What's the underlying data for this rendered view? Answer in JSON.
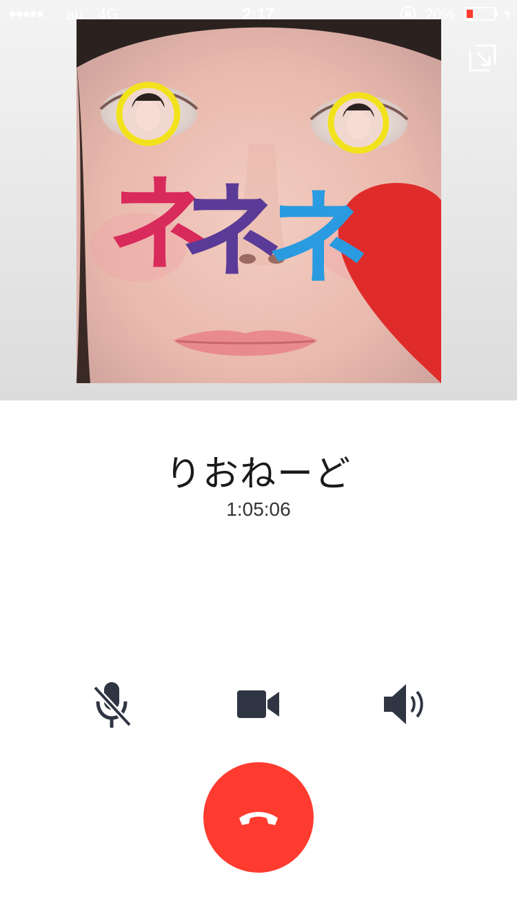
{
  "status": {
    "signal": "●●●●●",
    "carrier": "au",
    "network": "4G",
    "time": "2:17",
    "battery_percent": "20%"
  },
  "photo": {
    "sticker_text": "ネネネ"
  },
  "call": {
    "caller_name": "りおねーど",
    "duration": "1:05:06"
  },
  "controls": {
    "mute_icon": "mic-off-icon",
    "video_icon": "video-camera-icon",
    "speaker_icon": "speaker-icon",
    "end_icon": "hang-up-icon"
  },
  "colors": {
    "end_call": "#ff3b30",
    "icon": "#2f3542",
    "heart": "#e02b2b"
  }
}
